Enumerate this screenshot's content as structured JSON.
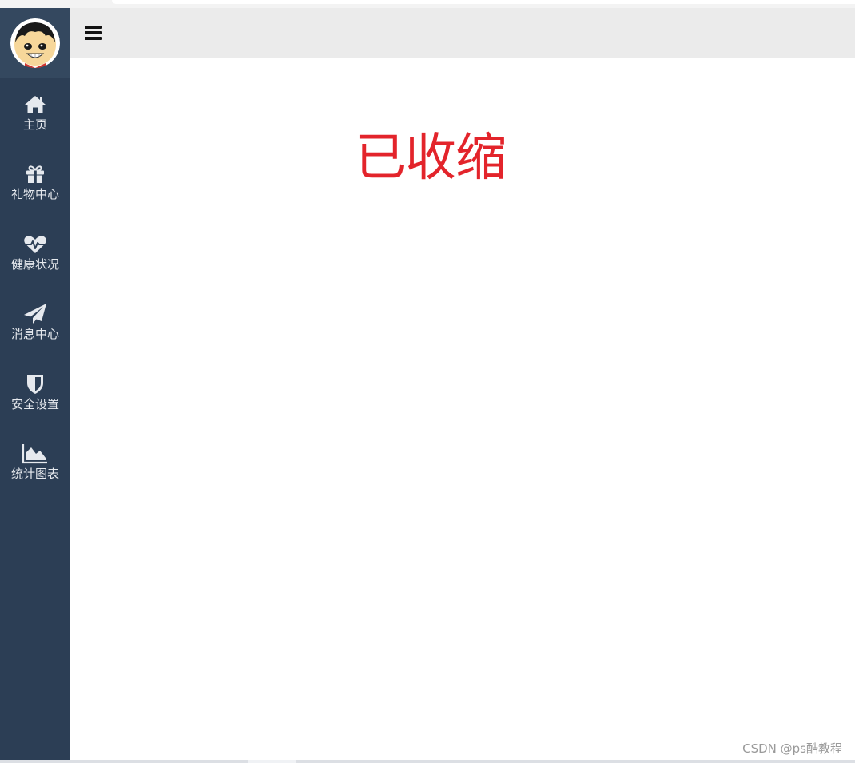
{
  "sidebar": {
    "items": [
      {
        "label": "主页",
        "icon": "home-icon"
      },
      {
        "label": "礼物中心",
        "icon": "gift-icon"
      },
      {
        "label": "健康状况",
        "icon": "heartbeat-icon"
      },
      {
        "label": "消息中心",
        "icon": "paper-plane-icon"
      },
      {
        "label": "安全设置",
        "icon": "shield-icon"
      },
      {
        "label": "统计图表",
        "icon": "area-chart-icon"
      }
    ]
  },
  "topbar": {
    "toggle_icon": "hamburger-menu-icon"
  },
  "main": {
    "status_text": "已收缩"
  },
  "watermark": "CSDN @ps酷教程",
  "colors": {
    "sidebar_bg": "#2c3e55",
    "topbar_bg": "#ebebeb",
    "status_text": "#e3242b"
  }
}
